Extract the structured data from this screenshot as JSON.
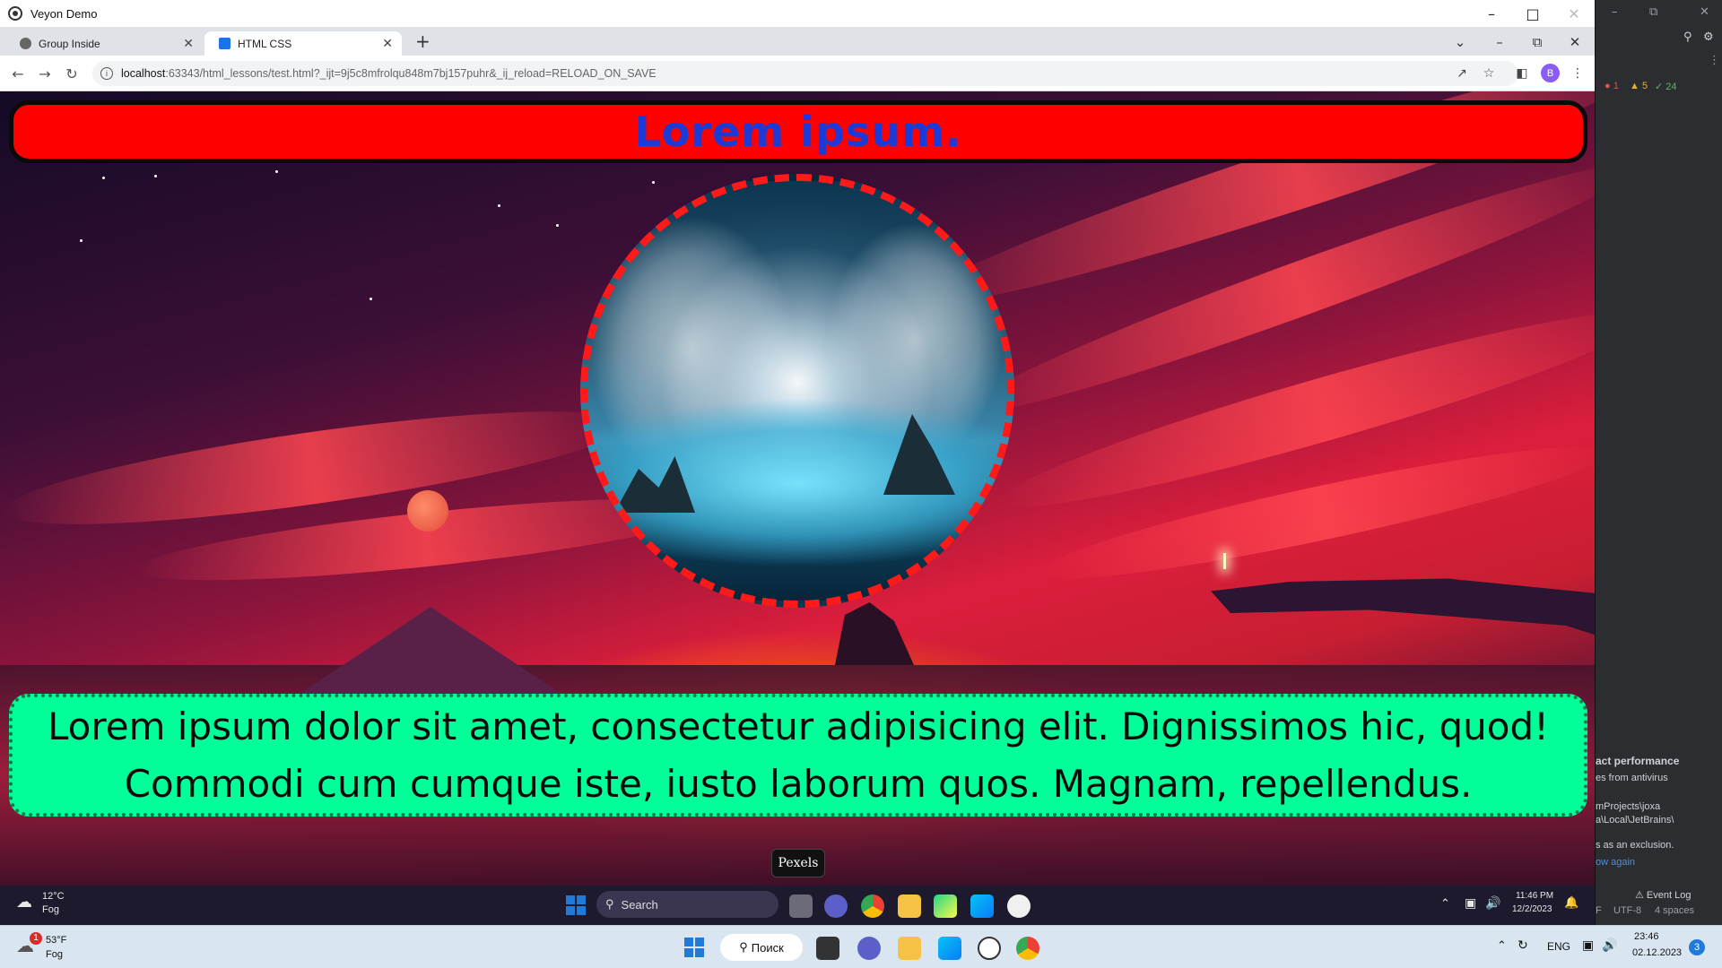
{
  "veyon": {
    "title": "Veyon Demo"
  },
  "browser": {
    "tabs": [
      {
        "label": "Group Inside"
      },
      {
        "label": "HTML CSS"
      }
    ],
    "url_host": "localhost",
    "url_path": ":63343/html_lessons/test.html?_ijt=9j5c8mfrolqu848m7bj157puhr&_ij_reload=RELOAD_ON_SAVE",
    "profile_initial": "B"
  },
  "page": {
    "heading": "Lorem ipsum.",
    "paragraph": "Lorem ipsum dolor sit amet, consectetur adipisicing elit. Dignissimos hic, quod! Commodi cum cumque iste, iusto laborum quos. Magnam, repellendus.",
    "tooltip": "Pexels"
  },
  "ide": {
    "errors": "1",
    "warnings": "5",
    "ok": "24",
    "notif_title": "act performance",
    "notif_line1": "es from antivirus",
    "notif_line2": "mProjects\\joxa",
    "notif_line3": "a\\Local\\JetBrains\\",
    "notif_line4": "s as an exclusion.",
    "notif_link": "ow again",
    "event_log": "Event Log",
    "encoding": "UTF-8",
    "indent": "4 spaces",
    "line_sep": "F"
  },
  "inner_taskbar": {
    "weather_temp": "12°C",
    "weather_desc": "Fog",
    "search": "Search",
    "time": "11:46 PM",
    "date": "12/2/2023"
  },
  "host_taskbar": {
    "weather_temp": "53°F",
    "weather_desc": "Fog",
    "search": "Поиск",
    "lang": "ENG",
    "time": "23:46",
    "date": "02.12.2023",
    "notif_count": "3"
  }
}
